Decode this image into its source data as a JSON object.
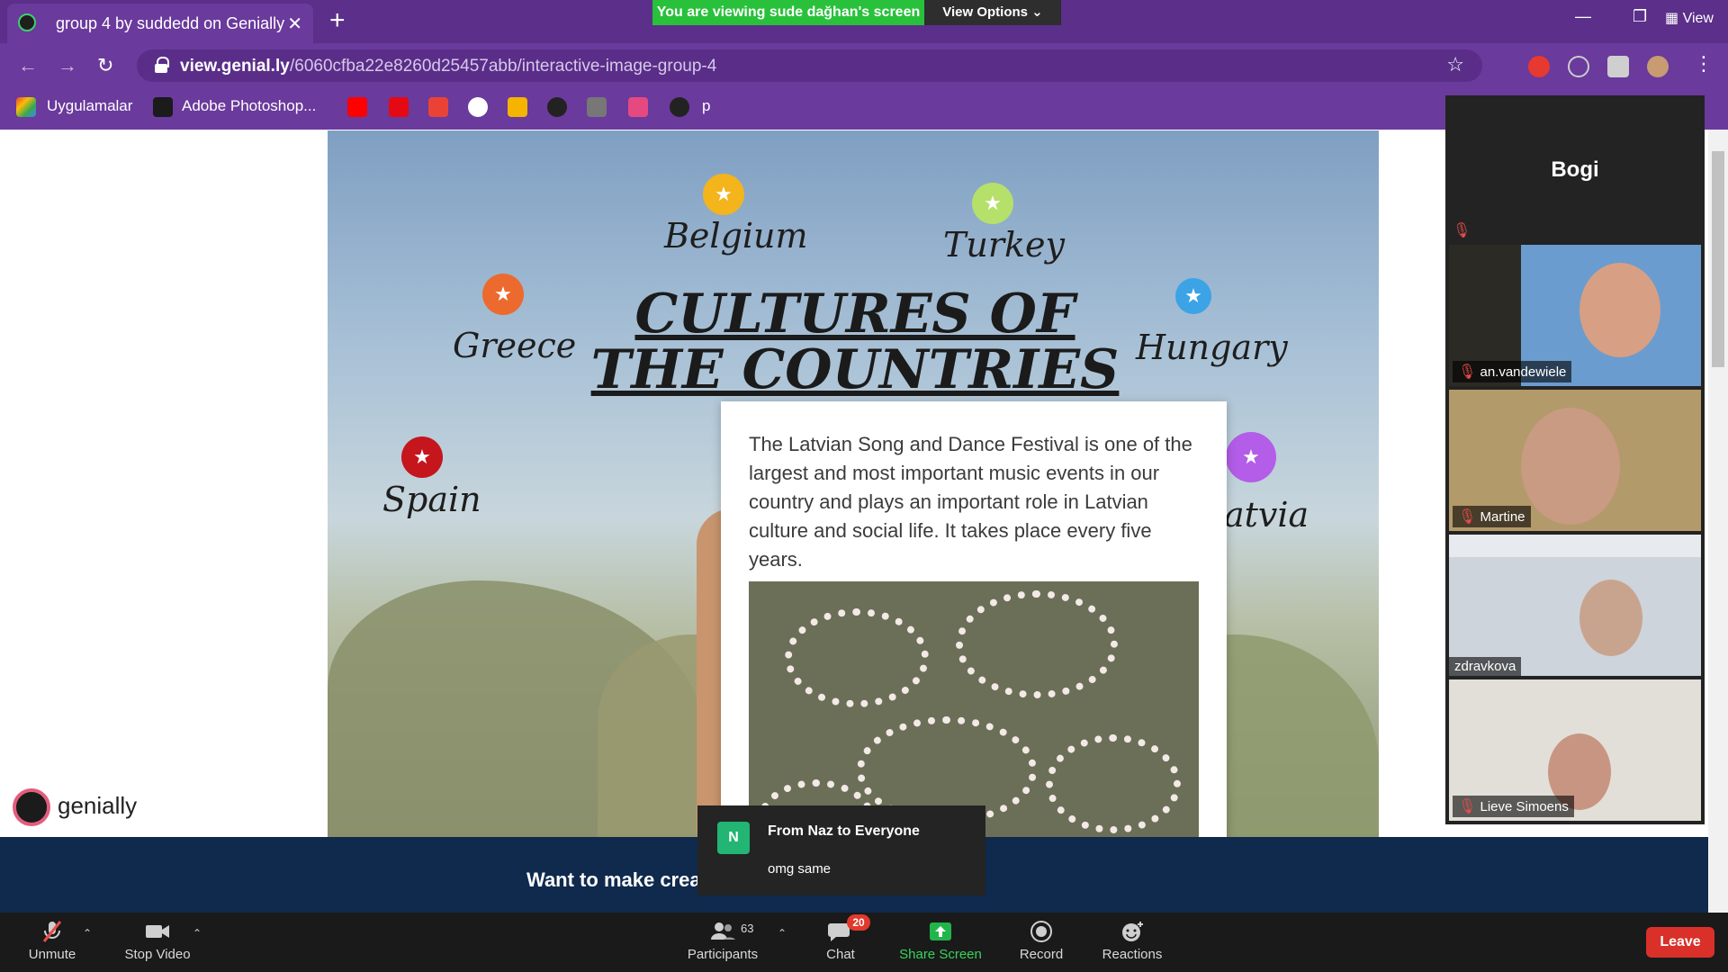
{
  "browser": {
    "tab_title": "group 4 by suddedd on Genially",
    "address_host": "view.genial.ly",
    "address_path": "/6060cfba22e8260d25457abb/interactive-image-group-4",
    "bookmarks": [
      "Uygulamalar",
      "Adobe Photoshop...",
      "p"
    ]
  },
  "zoom_banner": {
    "viewing": "You are viewing sude dağhan's screen",
    "view_options": "View Options",
    "view": "View"
  },
  "slide": {
    "title_line1": "CULTURES OF",
    "title_line2": "THE COUNTRIES",
    "countries": [
      "Belgium",
      "Turkey",
      "Greece",
      "Hungary",
      "Spain",
      "atvia"
    ],
    "popup_text": "The Latvian Song and Dance Festival is one of the largest and most important music events in our country and plays an important role in Latvian culture and social life. It takes place every five years.",
    "genially_brand": "genially",
    "promo": "Want to make crea"
  },
  "chat_toast": {
    "avatar_letter": "N",
    "from": "From Naz to Everyone",
    "message": "omg same"
  },
  "participants_panel": {
    "active_speaker": "Bogi",
    "tiles": [
      "an.vandewiele",
      "Martine",
      "zdravkova",
      "Lieve Simoens"
    ]
  },
  "toolbar": {
    "unmute": "Unmute",
    "stop_video": "Stop Video",
    "participants": "Participants",
    "participant_count": "63",
    "chat": "Chat",
    "chat_badge": "20",
    "share_screen": "Share Screen",
    "record": "Record",
    "reactions": "Reactions",
    "leave": "Leave"
  },
  "colors": {
    "chrome_purple": "#6a3a9c",
    "share_green": "#29c13b",
    "leave_red": "#d9302a",
    "pin_belgium": "#f3b41c",
    "pin_turkey": "#b5e06a",
    "pin_greece": "#ec6a2e",
    "pin_hungary": "#3ba3e6",
    "pin_spain": "#c4161c",
    "pin_latvia": "#b35de8"
  }
}
